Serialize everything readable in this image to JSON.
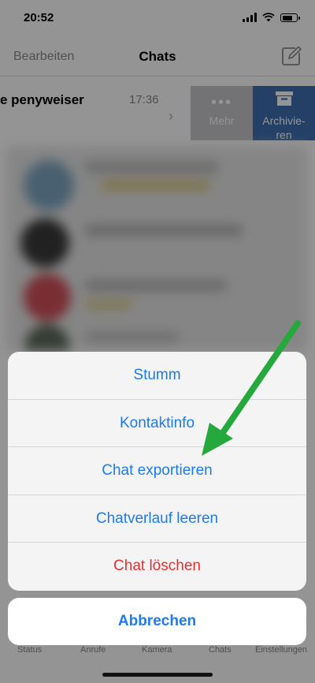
{
  "status": {
    "time": "20:52"
  },
  "navbar": {
    "edit_label": "Bearbeiten",
    "title": "Chats",
    "compose_icon": "compose-icon"
  },
  "chat_row": {
    "name": "e penyweiser",
    "time": "17:36",
    "more_label": "Mehr",
    "archive_label": "Archivie-\nren"
  },
  "action_sheet": {
    "items": [
      {
        "label": "Stumm"
      },
      {
        "label": "Kontaktinfo"
      },
      {
        "label": "Chat exportieren"
      },
      {
        "label": "Chatverlauf leeren"
      },
      {
        "label": "Chat löschen"
      }
    ],
    "cancel_label": "Abbrechen"
  },
  "tabbar": {
    "items": [
      {
        "label": "Status"
      },
      {
        "label": "Anrufe"
      },
      {
        "label": "Kamera"
      },
      {
        "label": "Chats"
      },
      {
        "label": "Einstellungen"
      }
    ]
  },
  "colors": {
    "accent": "#1b7bef",
    "danger": "#ee2c2c",
    "archive": "#3e6fb2",
    "more": "#c6c6cb",
    "arrow": "#25a83c"
  }
}
